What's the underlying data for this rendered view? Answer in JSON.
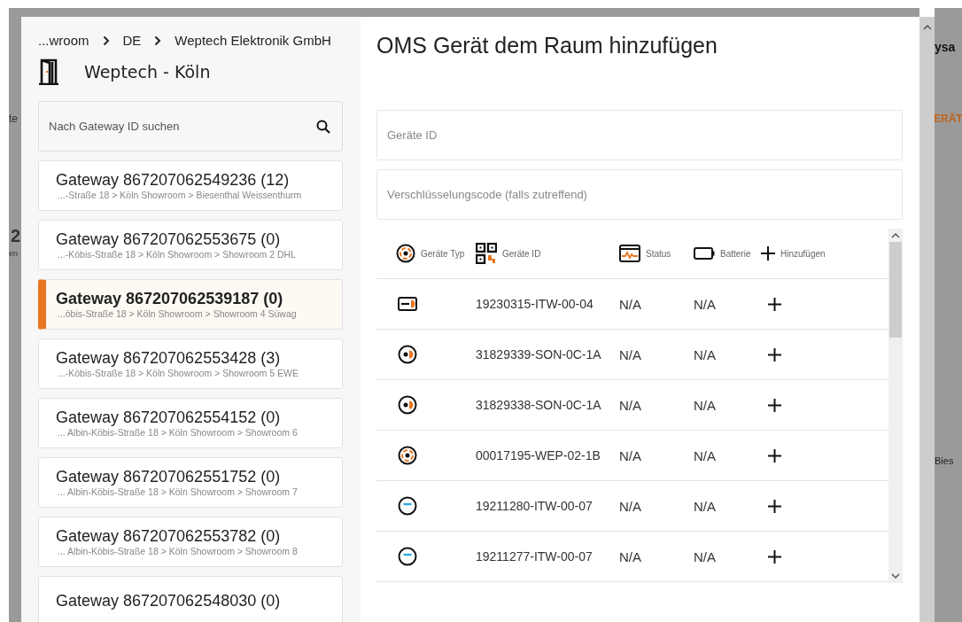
{
  "backdrop": {
    "left_texts": [
      "te",
      "2",
      "en"
    ],
    "right_texts": [
      "ysa",
      "ERÄT",
      "Bies"
    ]
  },
  "sidebar": {
    "breadcrumb": [
      "...wroom",
      "DE",
      "Weptech Elektronik GmbH"
    ],
    "room": "Weptech - Köln",
    "search": {
      "placeholder": "Nach Gateway ID suchen"
    },
    "gateways": [
      {
        "name": "Gateway 867207062549236 (12)",
        "path": "...-Straße 18 > Köln Showroom > Biesenthal Weissenthurm",
        "selected": false
      },
      {
        "name": "Gateway 867207062553675 (0)",
        "path": "...-Köbis-Straße 18 > Köln Showroom > Showroom 2 DHL",
        "selected": false
      },
      {
        "name": "Gateway 867207062539187 (0)",
        "path": "...öbis-Straße 18 > Köln Showroom > Showroom 4 Süwag",
        "selected": true
      },
      {
        "name": "Gateway 867207062553428 (3)",
        "path": "...-Köbis-Straße 18 > Köln Showroom > Showroom 5 EWE",
        "selected": false
      },
      {
        "name": "Gateway 867207062554152 (0)",
        "path": "... Albin-Köbis-Straße 18 > Köln Showroom > Showroom 6",
        "selected": false
      },
      {
        "name": "Gateway 867207062551752 (0)",
        "path": "... Albin-Köbis-Straße 18 > Köln Showroom > Showroom 7",
        "selected": false
      },
      {
        "name": "Gateway 867207062553782 (0)",
        "path": "... Albin-Köbis-Straße 18 > Köln Showroom > Showroom 8",
        "selected": false
      },
      {
        "name": "Gateway 867207062548030 (0)",
        "selected": false
      }
    ]
  },
  "dialog": {
    "title": "OMS Gerät dem Raum hinzufügen",
    "fields": [
      {
        "placeholder": "Geräte ID"
      },
      {
        "placeholder": "Verschlüsselungscode (falls zutreffend)"
      }
    ],
    "table": {
      "columns": [
        {
          "kind": "type",
          "label": "Geräte Typ"
        },
        {
          "kind": "id",
          "label": "Geräte ID"
        },
        {
          "kind": "status",
          "label": "Status"
        },
        {
          "kind": "battery",
          "label": "Batterie"
        },
        {
          "kind": "add",
          "label": "Hinzufügen"
        }
      ],
      "rows": [
        {
          "kind": "box",
          "id": "19230315-ITW-00-04",
          "status": "N/A",
          "battery": "N/A"
        },
        {
          "kind": "sonic",
          "id": "31829339-SON-0C-1A",
          "status": "N/A",
          "battery": "N/A"
        },
        {
          "kind": "sonic",
          "id": "31829338-SON-0C-1A",
          "status": "N/A",
          "battery": "N/A"
        },
        {
          "kind": "target",
          "id": "00017195-WEP-02-1B",
          "status": "N/A",
          "battery": "N/A"
        },
        {
          "kind": "dash",
          "id": "19211280-ITW-00-07",
          "status": "N/A",
          "battery": "N/A"
        },
        {
          "kind": "dash",
          "id": "19211277-ITW-00-07",
          "status": "N/A",
          "battery": "N/A"
        }
      ]
    }
  }
}
